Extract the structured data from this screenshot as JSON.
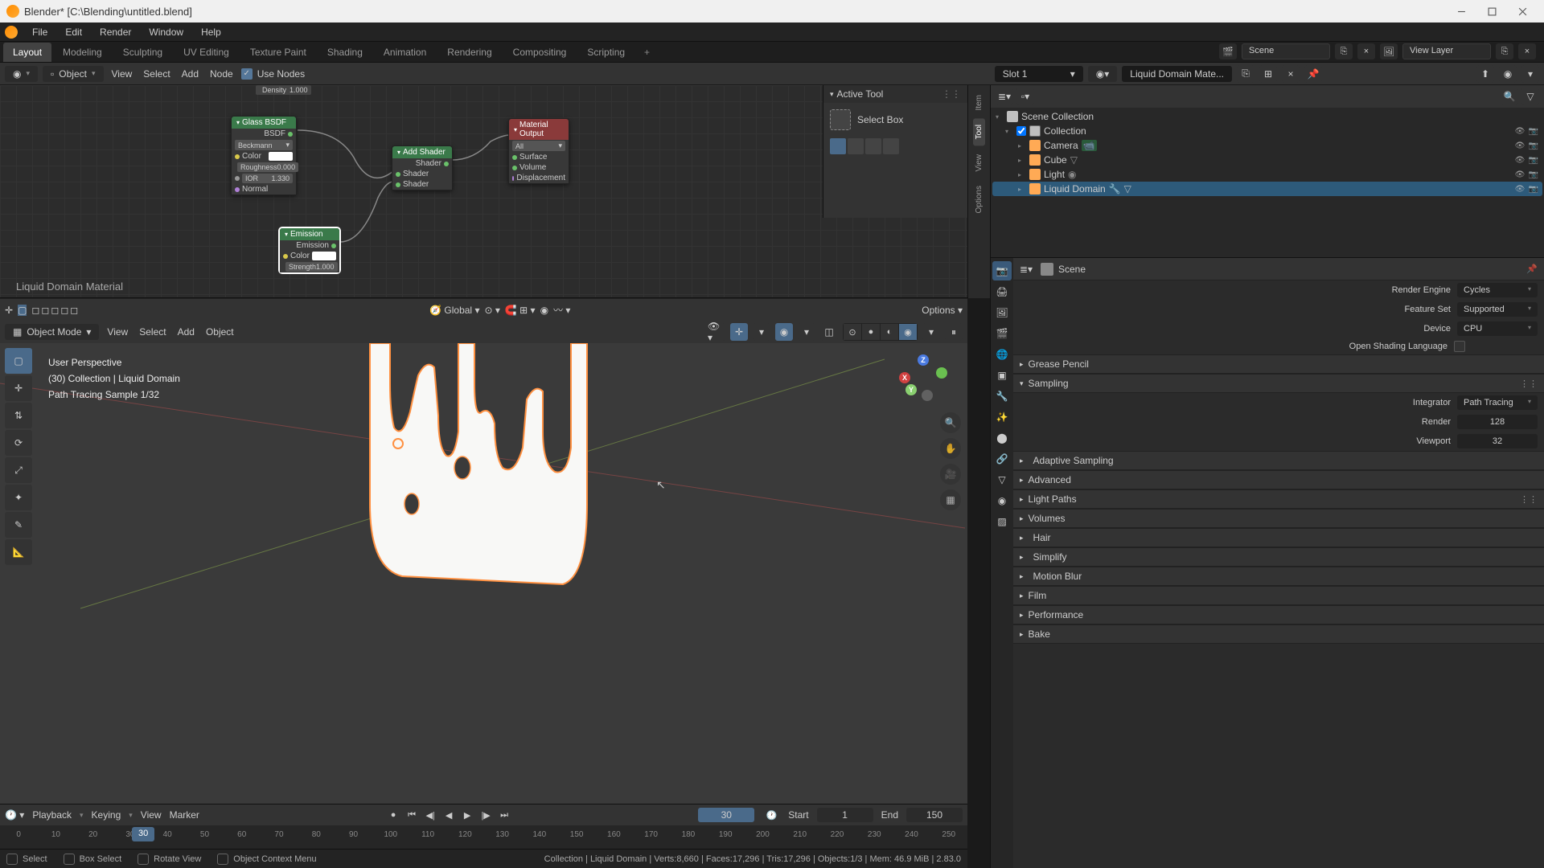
{
  "titlebar": {
    "title": "Blender* [C:\\Blending\\untitled.blend]"
  },
  "topmenu": [
    "File",
    "Edit",
    "Render",
    "Window",
    "Help"
  ],
  "workspaces": {
    "tabs": [
      "Layout",
      "Modeling",
      "Sculpting",
      "UV Editing",
      "Texture Paint",
      "Shading",
      "Animation",
      "Rendering",
      "Compositing",
      "Scripting"
    ],
    "active": "Layout",
    "scene_label": "Scene",
    "viewlayer_label": "View Layer"
  },
  "node_header": {
    "mode": "Object",
    "menus": [
      "View",
      "Select",
      "Add",
      "Node"
    ],
    "use_nodes": "Use Nodes",
    "slot": "Slot 1",
    "material": "Liquid Domain Mate..."
  },
  "nodes": {
    "density_label": "Density",
    "density_val": "1.000",
    "glass": {
      "title": "Glass BSDF",
      "out": "BSDF",
      "dist": "Beckmann",
      "r_color": "Color",
      "r_rough": "Roughness",
      "v_rough": "0.000",
      "r_ior": "IOR",
      "v_ior": "1.330",
      "r_normal": "Normal"
    },
    "add": {
      "title": "Add Shader",
      "out": "Shader",
      "in1": "Shader",
      "in2": "Shader"
    },
    "emission": {
      "title": "Emission",
      "out": "Emission",
      "r_color": "Color",
      "r_strength": "Strength",
      "v_strength": "1.000"
    },
    "output": {
      "title": "Material Output",
      "all": "All",
      "surface": "Surface",
      "volume": "Volume",
      "disp": "Displacement"
    },
    "mat_label": "Liquid Domain Material"
  },
  "active_tool": {
    "header": "Active Tool",
    "name": "Select Box"
  },
  "vp_subheader": {
    "global": "Global",
    "options": "Options"
  },
  "vp_header": {
    "mode": "Object Mode",
    "menus": [
      "View",
      "Select",
      "Add",
      "Object"
    ]
  },
  "vp_overlay": {
    "l1": "User Perspective",
    "l2": "(30) Collection | Liquid Domain",
    "l3": "Path Tracing Sample 1/32"
  },
  "timeline": {
    "menus": [
      "Playback",
      "Keying",
      "View",
      "Marker"
    ],
    "current": "30",
    "start_lbl": "Start",
    "start": "1",
    "end_lbl": "End",
    "end": "150",
    "ticks": [
      "0",
      "10",
      "20",
      "30",
      "40",
      "50",
      "60",
      "70",
      "80",
      "90",
      "100",
      "110",
      "120",
      "130",
      "140",
      "150",
      "160",
      "170",
      "180",
      "190",
      "200",
      "210",
      "220",
      "230",
      "240",
      "250"
    ]
  },
  "statusbar": {
    "select": "Select",
    "box_select": "Box Select",
    "rotate": "Rotate View",
    "context": "Object Context Menu",
    "info": "Collection | Liquid Domain | Verts:8,660 | Faces:17,296 | Tris:17,296 | Objects:1/3 | Mem: 46.9 MiB | 2.83.0"
  },
  "sidebar_tabs": [
    "Item",
    "Tool",
    "View",
    "Options"
  ],
  "outliner": {
    "scene_coll": "Scene Collection",
    "collection": "Collection",
    "camera": "Camera",
    "cube": "Cube",
    "light": "Light",
    "liquid": "Liquid Domain"
  },
  "properties": {
    "scene": "Scene",
    "render_engine_lbl": "Render Engine",
    "render_engine": "Cycles",
    "feature_set_lbl": "Feature Set",
    "feature_set": "Supported",
    "device_lbl": "Device",
    "device": "CPU",
    "osl": "Open Shading Language",
    "grease": "Grease Pencil",
    "sampling": "Sampling",
    "integrator_lbl": "Integrator",
    "integrator": "Path Tracing",
    "render_lbl": "Render",
    "render_val": "128",
    "viewport_lbl": "Viewport",
    "viewport_val": "32",
    "adaptive": "Adaptive Sampling",
    "advanced": "Advanced",
    "light_paths": "Light Paths",
    "volumes": "Volumes",
    "hair": "Hair",
    "simplify": "Simplify",
    "motion_blur": "Motion Blur",
    "film": "Film",
    "performance": "Performance",
    "bake": "Bake"
  }
}
